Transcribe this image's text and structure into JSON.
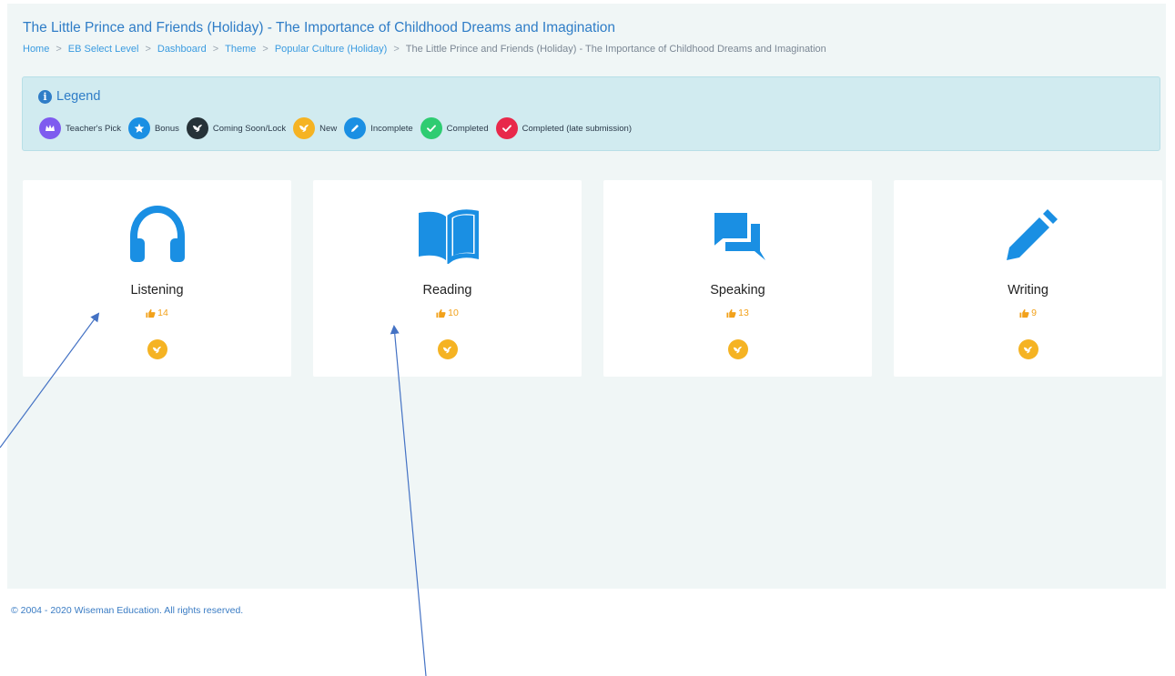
{
  "page": {
    "title": "The Little Prince and Friends (Holiday) - The Importance of Childhood Dreams and Imagination"
  },
  "breadcrumb": {
    "items": [
      {
        "label": "Home"
      },
      {
        "label": "EB Select Level"
      },
      {
        "label": "Dashboard"
      },
      {
        "label": "Theme"
      },
      {
        "label": "Popular Culture (Holiday)"
      }
    ],
    "current": "The Little Prince and Friends (Holiday) - The Importance of Childhood Dreams and Imagination",
    "separator": ">"
  },
  "legend": {
    "title": "Legend",
    "items": [
      {
        "label": "Teacher's Pick",
        "color": "#7e5bef",
        "icon": "crown-icon"
      },
      {
        "label": "Bonus",
        "color": "#1a8fe3",
        "icon": "star-icon"
      },
      {
        "label": "Coming Soon/Lock",
        "color": "#263238",
        "icon": "bird-icon"
      },
      {
        "label": "New",
        "color": "#f5b323",
        "icon": "bird-icon"
      },
      {
        "label": "Incomplete",
        "color": "#1a8fe3",
        "icon": "pencil-icon"
      },
      {
        "label": "Completed",
        "color": "#2ecc71",
        "icon": "check-icon"
      },
      {
        "label": "Completed (late submission)",
        "color": "#e8284a",
        "icon": "check-icon"
      }
    ]
  },
  "cards": [
    {
      "title": "Listening",
      "likes": "14",
      "icon": "headphones-icon",
      "status": "new"
    },
    {
      "title": "Reading",
      "likes": "10",
      "icon": "book-icon",
      "status": "new"
    },
    {
      "title": "Speaking",
      "likes": "13",
      "icon": "chat-icon",
      "status": "new"
    },
    {
      "title": "Writing",
      "likes": "9",
      "icon": "pencil-icon",
      "status": "new"
    }
  ],
  "colors": {
    "accent": "#1a8fe3",
    "new_badge": "#f5b323",
    "likes": "#f2a11a"
  },
  "footer": {
    "copyright": "© 2004 - 2020 Wiseman Education. All rights reserved."
  }
}
